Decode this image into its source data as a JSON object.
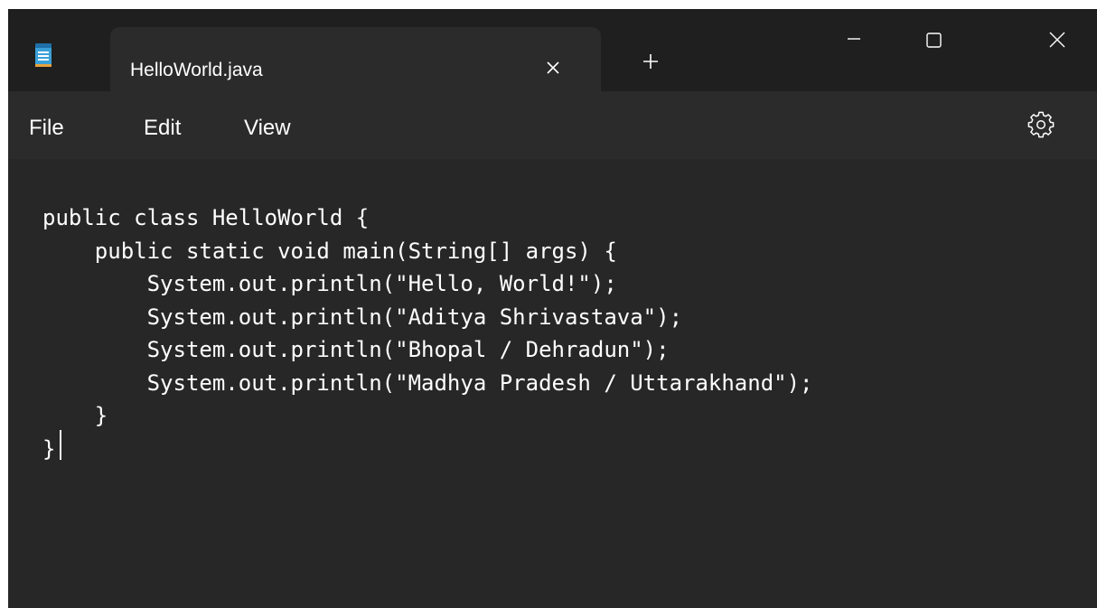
{
  "app": {
    "icon": "notepad-icon",
    "tab_title": "HelloWorld.java"
  },
  "titlebar_icons": {
    "tab_close": "close-icon",
    "new_tab": "plus-icon",
    "minimize": "minimize-icon",
    "maximize": "maximize-icon",
    "close": "close-icon"
  },
  "menu": {
    "file": "File",
    "edit": "Edit",
    "view": "View",
    "settings_icon": "gear-icon"
  },
  "editor": {
    "lines": [
      "public class HelloWorld {",
      "    public static void main(String[] args) {",
      "        System.out.println(\"Hello, World!\");",
      "        System.out.println(\"Aditya Shrivastava\");",
      "        System.out.println(\"Bhopal / Dehradun\");",
      "        System.out.println(\"Madhya Pradesh / Uttarakhand\");",
      "    }",
      "}"
    ]
  },
  "colors": {
    "titlebar_bg": "#1f1f1f",
    "tab_bg": "#2b2b2b",
    "editor_bg": "#272727",
    "text": "#ffffff",
    "icon_accent": "#3aa1d8"
  }
}
